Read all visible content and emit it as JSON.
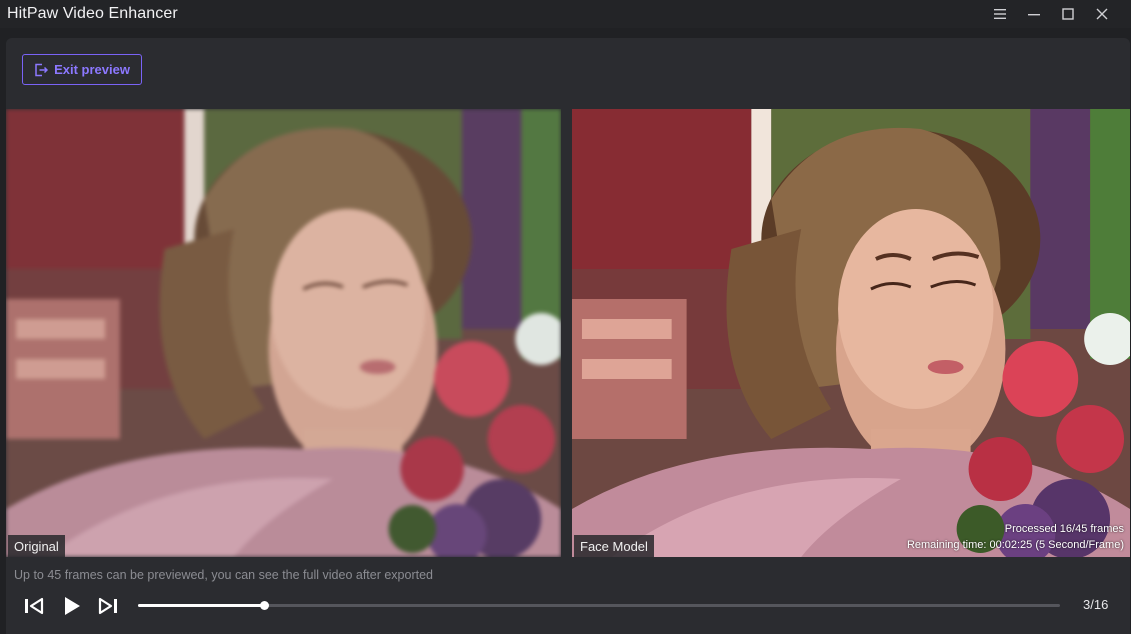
{
  "window": {
    "title": "HitPaw Video Enhancer",
    "controls": [
      "menu-icon",
      "minimize-icon",
      "maximize-icon",
      "close-icon"
    ]
  },
  "toolbar": {
    "exit_label": "Exit preview",
    "exit_icon": "exit-icon",
    "accent": "#7a63f6"
  },
  "preview": {
    "left_label": "Original",
    "right_label": "Face Model",
    "processed_text": "Processed 16/45 frames",
    "remaining_text": "Remaining time: 00:02:25 (5 Second/Frame)"
  },
  "footer": {
    "hint": "Up to 45 frames can be previewed, you can see the full video after exported",
    "progress": 0.137,
    "page_text": "3/16",
    "icons": [
      "previous-frame-icon",
      "play-icon",
      "next-frame-icon"
    ]
  }
}
